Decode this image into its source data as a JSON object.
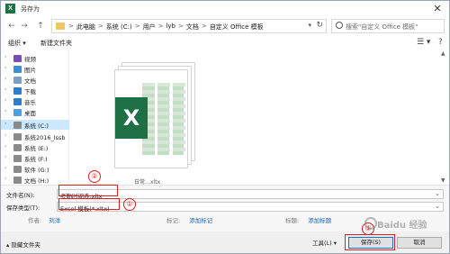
{
  "window": {
    "title": "另存为",
    "app_icon_letter": "X",
    "close_glyph": "✕"
  },
  "nav": {
    "back": "←",
    "forward": "→",
    "up": "↑",
    "breadcrumbs": [
      "此电脑",
      "系统 (C:)",
      "用户",
      "lyb",
      "文档",
      "自定义 Office 模板"
    ],
    "separator": ">",
    "search_placeholder": "搜索\"自定义 Office 模板\""
  },
  "toolbar": {
    "organize": "组织 ▾",
    "new_folder": "新建文件夹",
    "view_glyph": "☰ ▾",
    "help_glyph": "?"
  },
  "sidebar": {
    "items": [
      {
        "label": "视频",
        "icon": "video-icon",
        "color": "#7a4fb5"
      },
      {
        "label": "图片",
        "icon": "pictures-icon",
        "color": "#3a8fd6"
      },
      {
        "label": "文档",
        "icon": "documents-icon",
        "color": "#7c9fc7"
      },
      {
        "label": "下载",
        "icon": "download-icon",
        "color": "#2a7dd1"
      },
      {
        "label": "音乐",
        "icon": "music-icon",
        "color": "#2a7dd1"
      },
      {
        "label": "桌面",
        "icon": "desktop-icon",
        "color": "#4aa0e0"
      },
      {
        "label": "系统 (C:)",
        "icon": "drive-icon",
        "color": "#8a8a8a"
      },
      {
        "label": "系统2016_lssb",
        "icon": "drive-icon",
        "color": "#8a8a8a"
      },
      {
        "label": "系统 (E:)",
        "icon": "drive-icon",
        "color": "#8a8a8a"
      },
      {
        "label": "系统 (F:)",
        "icon": "drive-icon",
        "color": "#8a8a8a"
      },
      {
        "label": "软件 (G:)",
        "icon": "drive-icon",
        "color": "#8a8a8a"
      },
      {
        "label": "文档 (H:)",
        "icon": "drive-icon",
        "color": "#8a8a8a"
      }
    ],
    "selected_index": 6
  },
  "main": {
    "thumbnail_caption": "日常…xltx",
    "excel_letter": "X"
  },
  "fields": {
    "filename_label": "文件名(N):",
    "filename_value": "考勤时间表.xltx",
    "filetype_label": "保存类型(T):",
    "filetype_value": "Excel 模板(*.xltx)",
    "author_label": "作者:",
    "author_value": "刘洋",
    "tags_label": "标记:",
    "tags_value": "添加标记",
    "title_label": "标题:",
    "title_value": "添加标题"
  },
  "annotations": {
    "circle_1": "①",
    "circle_2": "②",
    "circle_3": "③",
    "color": "#e02020"
  },
  "bottom": {
    "hide_folders": "▴ 隐藏文件夹",
    "tools": "工具(L) ▾",
    "save": "保存(S)",
    "cancel": "取消"
  },
  "watermark": "Baidu 经验"
}
